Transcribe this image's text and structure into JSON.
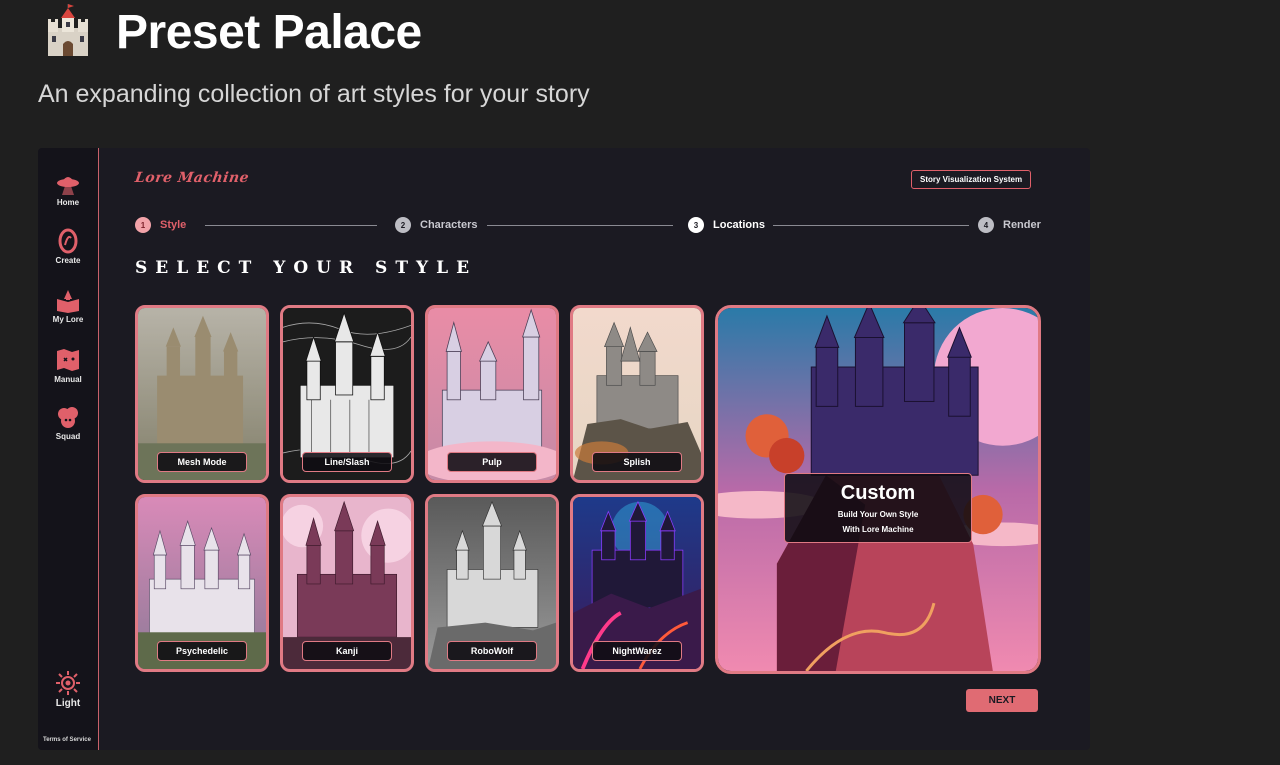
{
  "page": {
    "title": "Preset Palace",
    "subtitle": "An expanding collection of art styles for your story",
    "icon": "castle-icon"
  },
  "app": {
    "logo": "Lore Machine",
    "badge": "Story Visualization System",
    "section_title": "SELECT YOUR STYLE",
    "next_label": "NEXT",
    "accent": "#e0606a"
  },
  "sidebar": {
    "items": [
      {
        "label": "Home",
        "icon": "ufo-icon"
      },
      {
        "label": "Create",
        "icon": "swirl-icon"
      },
      {
        "label": "My Lore",
        "icon": "book-icon"
      },
      {
        "label": "Manual",
        "icon": "map-icon"
      },
      {
        "label": "Squad",
        "icon": "people-icon"
      }
    ],
    "light_label": "Light",
    "light_icon": "sun-icon",
    "terms": "Terms of Service"
  },
  "steps": [
    {
      "num": "1",
      "label": "Style",
      "state": "active"
    },
    {
      "num": "2",
      "label": "Characters",
      "state": "inactive"
    },
    {
      "num": "3",
      "label": "Locations",
      "state": "highlight"
    },
    {
      "num": "4",
      "label": "Render",
      "state": "inactive"
    }
  ],
  "styles": [
    {
      "label": "Mesh Mode",
      "palette": "fog"
    },
    {
      "label": "Line/Slash",
      "palette": "ink"
    },
    {
      "label": "Pulp",
      "palette": "pink"
    },
    {
      "label": "Splish",
      "palette": "watercolor"
    },
    {
      "label": "Psychedelic",
      "palette": "purple"
    },
    {
      "label": "Kanji",
      "palette": "rose"
    },
    {
      "label": "RoboWolf",
      "palette": "grey"
    },
    {
      "label": "NightWarez",
      "palette": "neon"
    }
  ],
  "custom": {
    "title": "Custom",
    "line1": "Build Your Own Style",
    "line2": "With Lore Machine"
  }
}
